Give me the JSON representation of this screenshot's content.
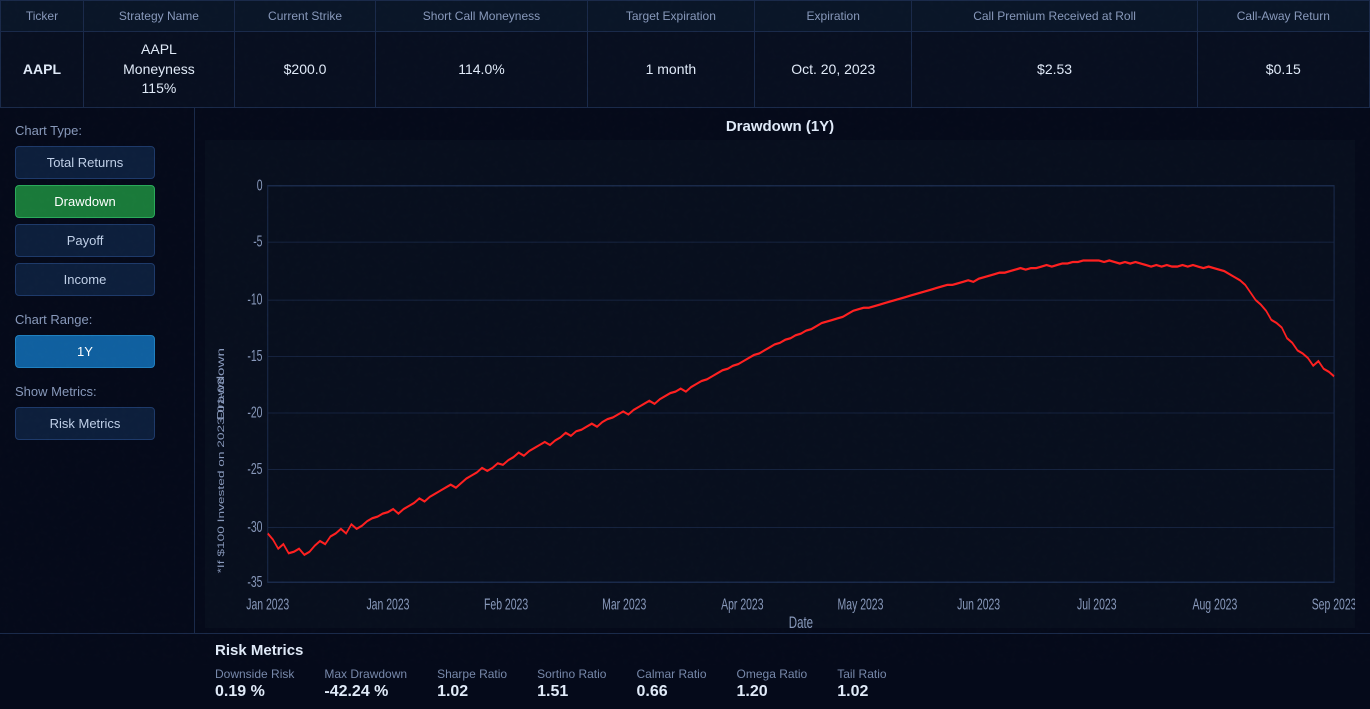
{
  "header": {
    "columns": [
      "Ticker",
      "Strategy Name",
      "Current Strike",
      "Short Call Moneyness",
      "Target Expiration",
      "Expiration",
      "Call Premium Received at Roll",
      "Call-Away Return"
    ],
    "row": {
      "ticker": "AAPL",
      "strategy_name_line1": "AAPL",
      "strategy_name_line2": "Moneyness",
      "strategy_name_line3": "115%",
      "current_strike": "$200.0",
      "short_call_moneyness": "114.0%",
      "target_expiration": "1 month",
      "expiration": "Oct. 20, 2023",
      "call_premium": "$2.53",
      "call_away_return": "$0.15"
    }
  },
  "sidebar": {
    "chart_type_label": "Chart Type:",
    "buttons": {
      "total_returns": "Total Returns",
      "drawdown": "Drawdown",
      "payoff": "Payoff",
      "income": "Income"
    },
    "chart_range_label": "Chart Range:",
    "range_btn": "1Y",
    "show_metrics_label": "Show Metrics:",
    "metrics_btn": "Risk Metrics"
  },
  "chart": {
    "title": "Drawdown (1Y)",
    "y_axis_label": "Drawdown\n*If $100 Invested on 2023-01-03",
    "x_axis_label": "Date",
    "y_ticks": [
      "0",
      "-5",
      "-10",
      "-15",
      "-20",
      "-25",
      "-30",
      "-35"
    ],
    "x_ticks": [
      "Jan 2023",
      "Jan 2023",
      "Feb 2023",
      "Mar 2023",
      "Apr 2023",
      "May 2023",
      "Jun 2023",
      "Jul 2023",
      "Aug 2023",
      "Sep 2023"
    ]
  },
  "risk_metrics": {
    "title": "Risk Metrics",
    "items": [
      {
        "label": "Downside Risk",
        "value": "0.19 %"
      },
      {
        "label": "Max Drawdown",
        "value": "-42.24 %"
      },
      {
        "label": "Sharpe Ratio",
        "value": "1.02"
      },
      {
        "label": "Sortino Ratio",
        "value": "1.51"
      },
      {
        "label": "Calmar Ratio",
        "value": "0.66"
      },
      {
        "label": "Omega Ratio",
        "value": "1.20"
      },
      {
        "label": "Tail Ratio",
        "value": "1.02"
      }
    ]
  },
  "colors": {
    "bg_dark": "#050a1a",
    "bg_medium": "#0a1628",
    "accent_green": "#1a7a3a",
    "accent_blue": "#1060a0",
    "line_red": "#ff3030",
    "grid_color": "#1a2a4a",
    "text_dim": "#7788aa",
    "text_bright": "#e0eaf8"
  }
}
